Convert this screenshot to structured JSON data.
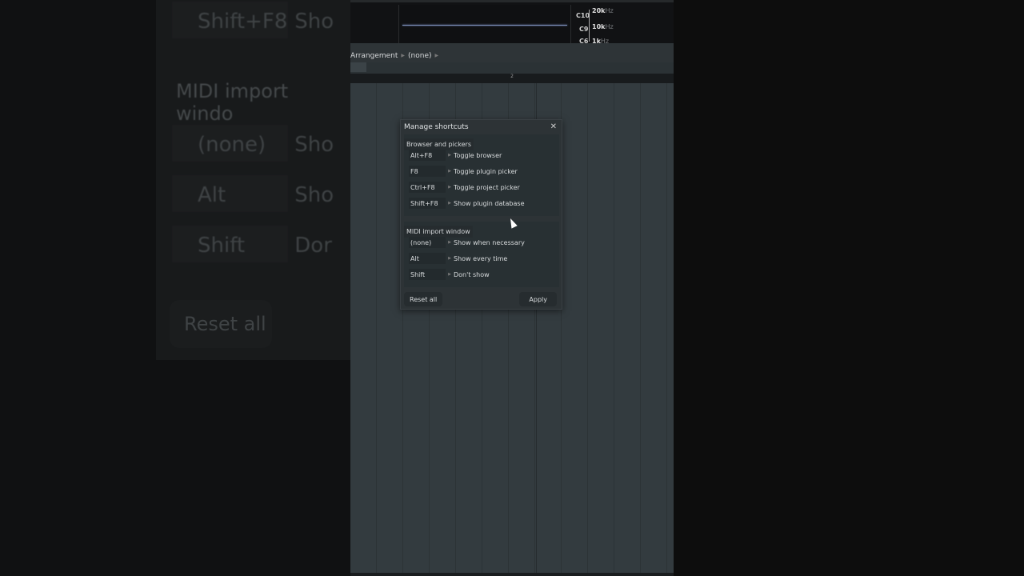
{
  "background": {
    "rows": [
      {
        "key": "Shift+F8",
        "action": "Sho"
      },
      {
        "key": "(none)",
        "action": "Sho"
      },
      {
        "key": "Alt",
        "action": "Sho"
      },
      {
        "key": "Shift",
        "action": "Dor"
      }
    ],
    "section": "MIDI import windo",
    "reset": "Reset all"
  },
  "scope": {
    "freqs": [
      {
        "value": "20k",
        "unit": "Hz"
      },
      {
        "value": "10k",
        "unit": "Hz"
      },
      {
        "value": "1k",
        "unit": "Hz"
      }
    ],
    "notes": [
      "C10",
      "C9",
      "C6"
    ]
  },
  "breadcrumb": {
    "items": [
      "Arrangement",
      "(none)"
    ]
  },
  "ruler": {
    "marker": "2"
  },
  "dialog": {
    "title": "Manage shortcuts",
    "close": "✕",
    "sections": [
      {
        "header": "Browser and pickers",
        "rows": [
          {
            "key": "Alt+F8",
            "action": "Toggle browser"
          },
          {
            "key": "F8",
            "action": "Toggle plugin picker"
          },
          {
            "key": "Ctrl+F8",
            "action": "Toggle project picker"
          },
          {
            "key": "Shift+F8",
            "action": "Show plugin database"
          }
        ]
      },
      {
        "header": "MIDI import window",
        "rows": [
          {
            "key": "(none)",
            "action": "Show when necessary"
          },
          {
            "key": "Alt",
            "action": "Show every time"
          },
          {
            "key": "Shift",
            "action": "Don't show"
          }
        ]
      }
    ],
    "reset_label": "Reset all",
    "apply_label": "Apply"
  }
}
